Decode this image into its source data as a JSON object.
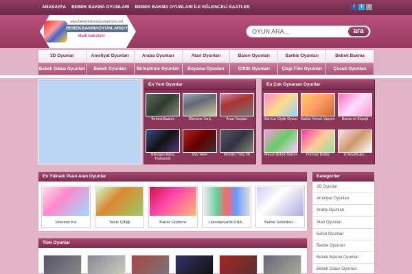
{
  "topnav": [
    "ANASAYFA",
    "BEBEK BAKMA OYUNLARI",
    "BEBEK BAKMA OYUNLARI İLE EĞLENCELİ SAATLER"
  ],
  "social": [
    {
      "name": "facebook-icon",
      "glyph": "f",
      "color": "#3b5998"
    },
    {
      "name": "twitter-icon",
      "glyph": "t",
      "color": "#33a6dd"
    },
    {
      "name": "rss-icon",
      "glyph": "r",
      "color": "#999999"
    }
  ],
  "logo": {
    "line1": "www.bebekbakmaoyunlarioyna.net",
    "line2": "BEBEKBAKMAOYUNLARIOYNA.NET",
    "line3": "Hadi bakalım!"
  },
  "search": {
    "placeholder": "OYUN ARA...",
    "button": "ara"
  },
  "menu": {
    "row1": [
      "3D Oyunlar",
      "Ameliyat Oyunları",
      "Araba Oyunları",
      "Atari Oyunları",
      "Balon Oyunları",
      "Barbie Oyunları",
      "Bebek Bakma"
    ],
    "row2": [
      "Bebek Odası Oyunları",
      "Bebek Oyunları",
      "Birleştirme Oyunları",
      "Boyama Oyunları",
      "Çiftlik Oyunları",
      "Çizgi Film Oyunları",
      "Çocuk Oyunları"
    ]
  },
  "newest": {
    "title": "En Yeni Oyunlar",
    "games": [
      "Terörist Baskını",
      "Ölümüne Yarış",
      "Arazi Yarışları",
      "Bakugan Alpha Hydranoid",
      "Dev Teker",
      "Monster Yarış 3D"
    ]
  },
  "mostplayed": {
    "title": "En Çok Oynanan Oyunlar",
    "games": [
      "Bal Kızı Giydir Oyunu",
      "Barbie Yemek Yapıyor",
      "Barbie ve Köpeği",
      "Afacan Bebek Bakımı",
      "Prenses Barbie",
      "10 kevelli giyi..."
    ]
  },
  "toprated": {
    "title": "En Yüksek Puan Alan Oyunlar",
    "games": [
      "Veteriner Kız",
      "Tavuk Çiftliği",
      "Barbie Giydirme",
      "Laboratuvarda DNA...",
      "Barbie Gelinlikler..."
    ]
  },
  "categories": {
    "title": "Kategoriler",
    "items": [
      "3D Oyunlar",
      "Ameliyat Oyunları",
      "Araba Oyunları",
      "Atari Oyunları",
      "Balon Oyunları",
      "Barbie Oyunları",
      "Bebek Bakma Oyunları",
      "Bebek Odası Oyunları"
    ]
  },
  "allgames": {
    "title": "Tüm Oyunlar"
  },
  "colors": {
    "brand": "#8e3d61",
    "accent": "#b8517b",
    "bg": "#e2b4c7"
  }
}
